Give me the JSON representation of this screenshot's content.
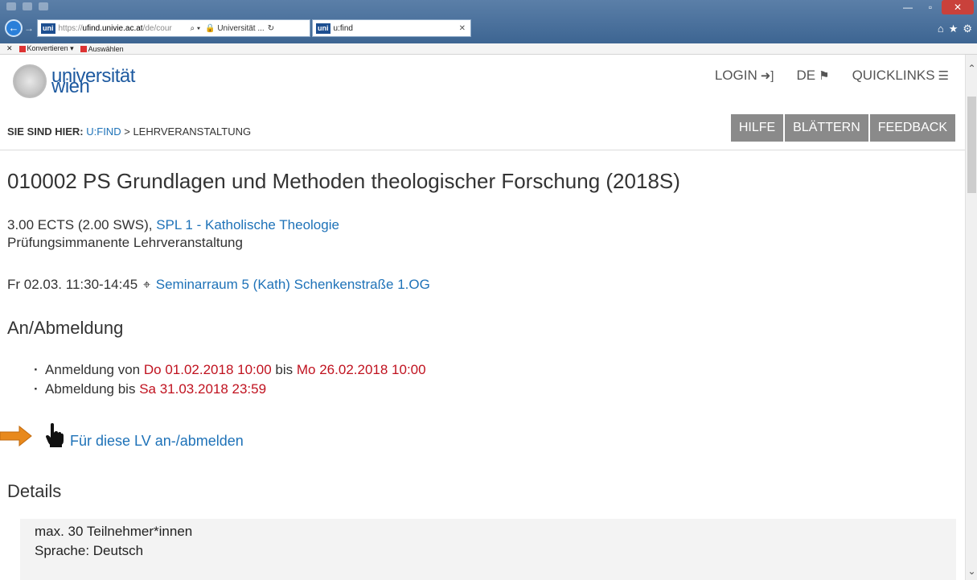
{
  "browser": {
    "address_url_prefix": "https://",
    "address_url_host": "ufind.univie.ac.at",
    "address_url_path": "/de/cour",
    "address_site": "Universität ...",
    "tab_favicon": "uni",
    "tab_title": "u:find",
    "fav_convert": "Konvertieren",
    "fav_select": "Auswählen"
  },
  "header": {
    "logo_line1": "universität",
    "logo_line2": "wien",
    "login": "LOGIN",
    "lang": "DE",
    "quicklinks": "QUICKLINKS"
  },
  "breadcrumb": {
    "lead": "SIE SIND HIER:",
    "home": "U:FIND",
    "sep": ">",
    "current": "LEHRVERANSTALTUNG"
  },
  "buttons": {
    "hilfe": "HILFE",
    "blaettern": "BLÄTTERN",
    "feedback": "FEEDBACK"
  },
  "course": {
    "title": "010002 PS Grundlagen und Methoden theologischer Forschung (2018S)",
    "ects": "3.00 ECTS (2.00 SWS),",
    "spl_link": "SPL 1 - Katholische Theologie",
    "type": "Prüfungsimmanente Lehrveranstaltung",
    "date": "Fr 02.03. 11:30-14:45",
    "room_link": "Seminarraum 5 (Kath) Schenkenstraße 1.OG"
  },
  "registration": {
    "heading": "An/Abmeldung",
    "anmeldung_prefix": "Anmeldung von",
    "anmeldung_from": "Do 01.02.2018 10:00",
    "anmeldung_mid": "bis",
    "anmeldung_to": "Mo 26.02.2018 10:00",
    "abmeldung_prefix": "Abmeldung bis",
    "abmeldung_to": "Sa 31.03.2018 23:59",
    "signup_link": "Für diese LV an-/abmelden"
  },
  "details": {
    "heading": "Details",
    "line1": "max. 30 Teilnehmer*innen",
    "line2": "Sprache: Deutsch"
  },
  "colors": {
    "link": "#1e72b8",
    "date_red": "#c0121f",
    "button_gray": "#8a8a8a",
    "arrow_orange": "#e8891c"
  }
}
